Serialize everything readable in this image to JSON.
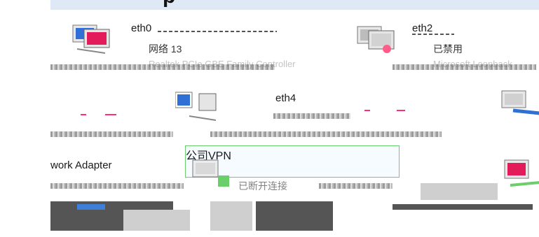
{
  "header": {
    "title": "p"
  },
  "connections": [
    {
      "name": "eth0",
      "status": "网络  13",
      "device": "Realtek PCIe GBE Family Controller"
    },
    {
      "name": "eth2",
      "status": "已禁用",
      "device": "Microsoft Loopback"
    },
    {
      "name": "eth4",
      "status": "",
      "device": ""
    },
    {
      "name": "",
      "status": "",
      "device": "work Adapter"
    },
    {
      "name": "公司VPN",
      "status": "已断开连接",
      "device": "WAN Miniport"
    }
  ],
  "colors": {
    "accent_green": "#6acf6a",
    "monitor_blue": "#2f6fd6",
    "cable_pink": "#ff2d7a"
  }
}
